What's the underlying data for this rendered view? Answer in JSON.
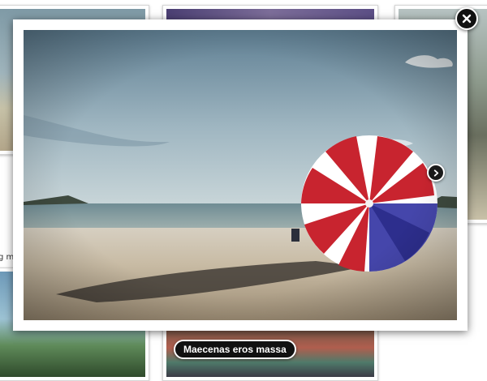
{
  "gallery": {
    "side_caption": "g m"
  },
  "lightbox": {
    "caption": "Maecenas eros massa",
    "icons": {
      "close": "close-icon",
      "next": "chevron-right-icon"
    }
  },
  "colors": {
    "button_background": "#111111",
    "button_border": "#ffffff",
    "frame": "#ffffff"
  }
}
